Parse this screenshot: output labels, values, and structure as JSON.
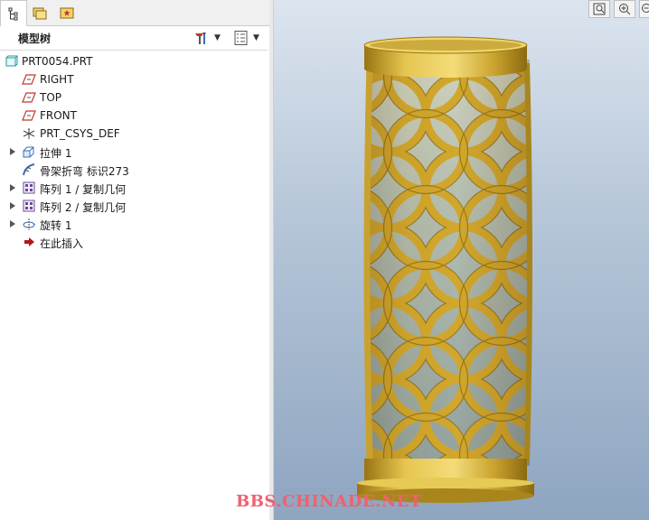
{
  "tabs": [
    {
      "icon": "model-tree-tab-icon"
    },
    {
      "icon": "folder-browser-tab-icon"
    },
    {
      "icon": "favorites-tab-icon"
    }
  ],
  "panel": {
    "title": "模型树",
    "settings_icon": "tree-settings-icon",
    "filter_icon": "tree-filter-icon"
  },
  "tree": [
    {
      "label": "PRT0054.PRT",
      "icon": "part-icon",
      "expandable": false,
      "level": 0
    },
    {
      "label": "RIGHT",
      "icon": "datum-plane-icon",
      "expandable": false,
      "level": 1
    },
    {
      "label": "TOP",
      "icon": "datum-plane-icon",
      "expandable": false,
      "level": 1
    },
    {
      "label": "FRONT",
      "icon": "datum-plane-icon",
      "expandable": false,
      "level": 1
    },
    {
      "label": "PRT_CSYS_DEF",
      "icon": "csys-icon",
      "expandable": false,
      "level": 1
    },
    {
      "label": "拉伸 1",
      "icon": "extrude-icon",
      "expandable": true,
      "level": 1
    },
    {
      "label": "骨架折弯 标识273",
      "icon": "spinal-bend-icon",
      "expandable": false,
      "level": 1
    },
    {
      "label": "阵列 1 / 复制几何",
      "icon": "pattern-icon",
      "expandable": true,
      "level": 1
    },
    {
      "label": "阵列 2 / 复制几何",
      "icon": "pattern-icon",
      "expandable": true,
      "level": 1
    },
    {
      "label": "旋转 1",
      "icon": "revolve-icon",
      "expandable": true,
      "level": 1
    },
    {
      "label": "在此插入",
      "icon": "insert-here-arrow-icon",
      "expandable": false,
      "level": 1
    }
  ],
  "view_toolbar": [
    {
      "icon": "zoom-fit-icon"
    },
    {
      "icon": "zoom-in-icon"
    },
    {
      "icon": "zoom-out-icon"
    }
  ],
  "watermark": "BBS.CHINADE.NET",
  "colors": {
    "gold": "#d8b43a",
    "gold_dark": "#8a6a10",
    "gold_light": "#f3dc7a",
    "bg_top": "#dce5ef",
    "bg_bottom": "#8ea5c0",
    "watermark": "#f06070"
  }
}
